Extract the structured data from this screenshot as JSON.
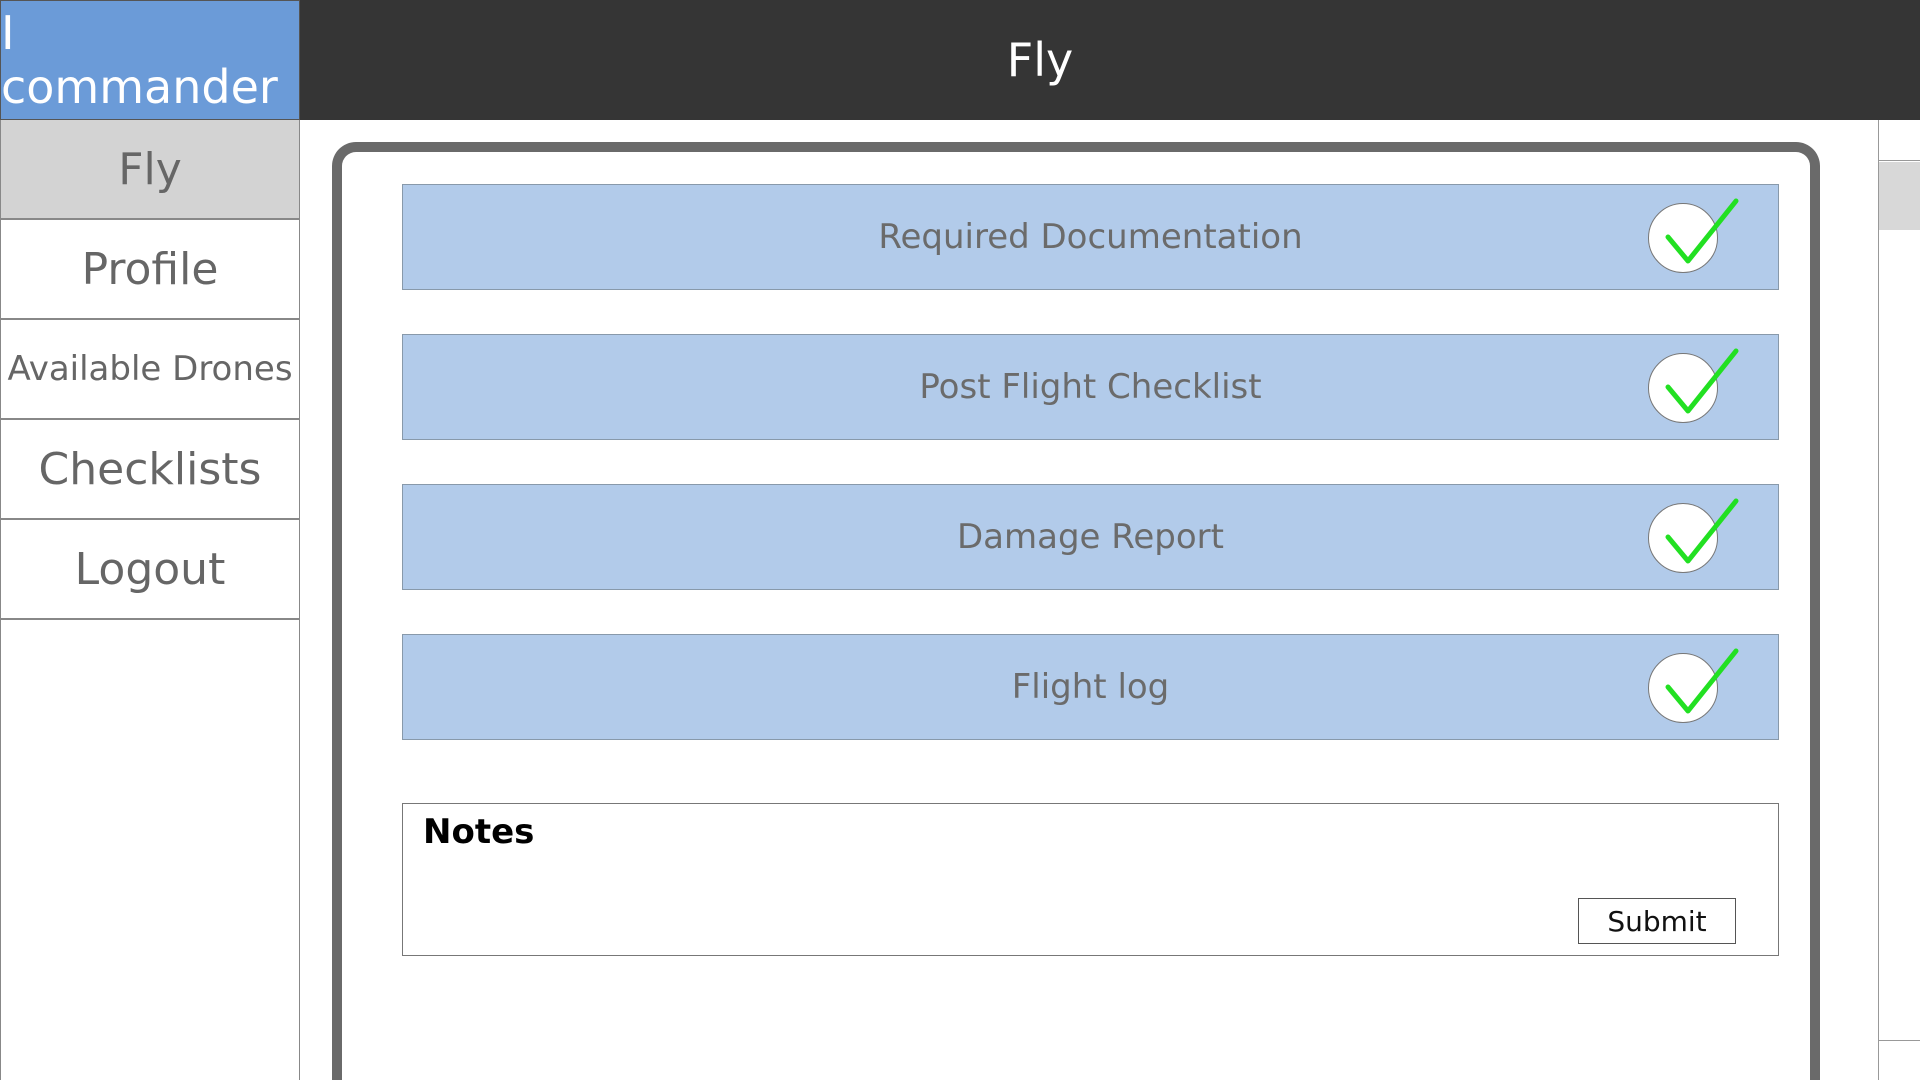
{
  "app": {
    "brand": "I commander"
  },
  "header": {
    "title": "Fly"
  },
  "sidebar": {
    "items": [
      {
        "label": "Fly",
        "active": true
      },
      {
        "label": "Profile"
      },
      {
        "label": "Available Drones"
      },
      {
        "label": "Checklists"
      },
      {
        "label": "Logout"
      }
    ]
  },
  "checklist": {
    "items": [
      {
        "label": "Required Documentation",
        "checked": true,
        "icon": "check-icon"
      },
      {
        "label": "Post Flight Checklist",
        "checked": true,
        "icon": "check-icon"
      },
      {
        "label": "Damage Report",
        "checked": true,
        "icon": "check-icon"
      },
      {
        "label": "Flight log",
        "checked": true,
        "icon": "check-icon"
      }
    ]
  },
  "notes": {
    "title": "Notes",
    "submit_label": "Submit"
  },
  "colors": {
    "brand": "#6b9bd8",
    "header": "#353535",
    "row": "#b2cbea",
    "check": "#22e022",
    "active_nav": "#d3d3d3"
  }
}
